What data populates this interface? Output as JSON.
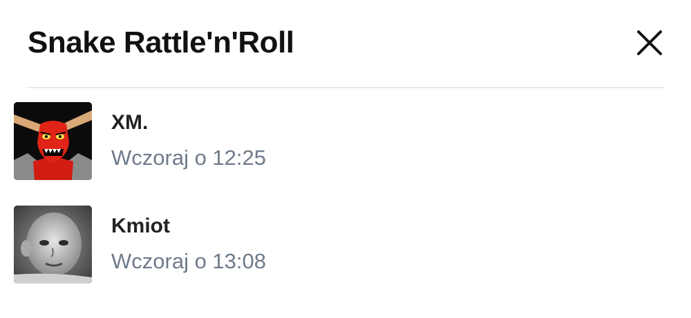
{
  "dialog": {
    "title": "Snake Rattle'n'Roll",
    "close_icon": "close-icon"
  },
  "users": [
    {
      "name": "XM.",
      "time": "Wczoraj o 12:25",
      "avatar": "red-devil-avatar"
    },
    {
      "name": "Kmiot",
      "time": "Wczoraj o 13:08",
      "avatar": "baby-photo-avatar"
    }
  ]
}
